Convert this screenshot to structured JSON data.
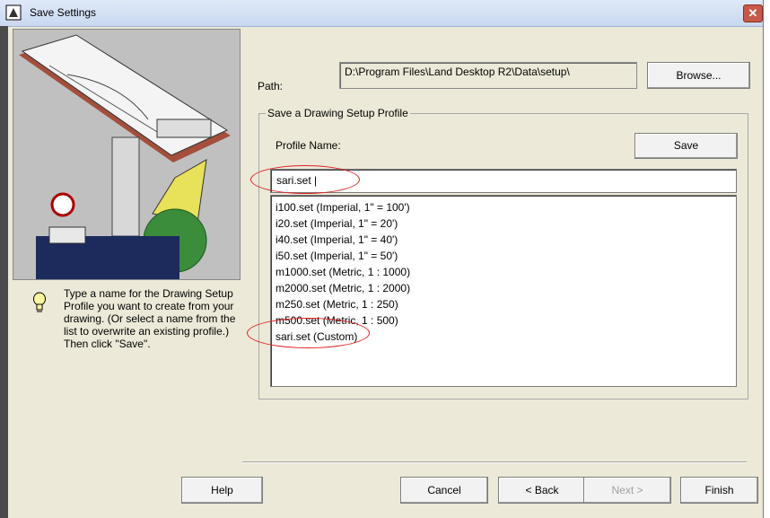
{
  "window": {
    "title": "Save Settings"
  },
  "path": {
    "label": "Path:",
    "value": "D:\\Program Files\\Land Desktop R2\\Data\\setup\\",
    "browse_label": "Browse..."
  },
  "profile_group": {
    "title": "Save a Drawing Setup Profile",
    "name_label": "Profile Name:",
    "save_label": "Save",
    "name_value": "sari.set |",
    "items": [
      {
        "label": "i100.set  (Imperial, 1\" = 100')"
      },
      {
        "label": "i20.set  (Imperial, 1\" = 20')"
      },
      {
        "label": "i40.set  (Imperial, 1\" = 40')"
      },
      {
        "label": "i50.set  (Imperial, 1\" = 50')"
      },
      {
        "label": "m1000.set  (Metric, 1 : 1000)"
      },
      {
        "label": "m2000.set  (Metric, 1 : 2000)"
      },
      {
        "label": "m250.set  (Metric, 1 : 250)"
      },
      {
        "label": "m500.set  (Metric, 1 : 500)"
      },
      {
        "label": "sari.set  (Custom)"
      }
    ]
  },
  "hint": {
    "text": "Type a name for the Drawing Setup Profile you want to create from your drawing.  (Or select a name from the list to overwrite an existing profile.)  Then click \"Save\"."
  },
  "footer": {
    "help": "Help",
    "cancel": "Cancel",
    "back": "< Back",
    "next": "Next >",
    "finish": "Finish"
  },
  "colors": {
    "annotation": "#e02020",
    "dialog_bg": "#ece9d8"
  }
}
